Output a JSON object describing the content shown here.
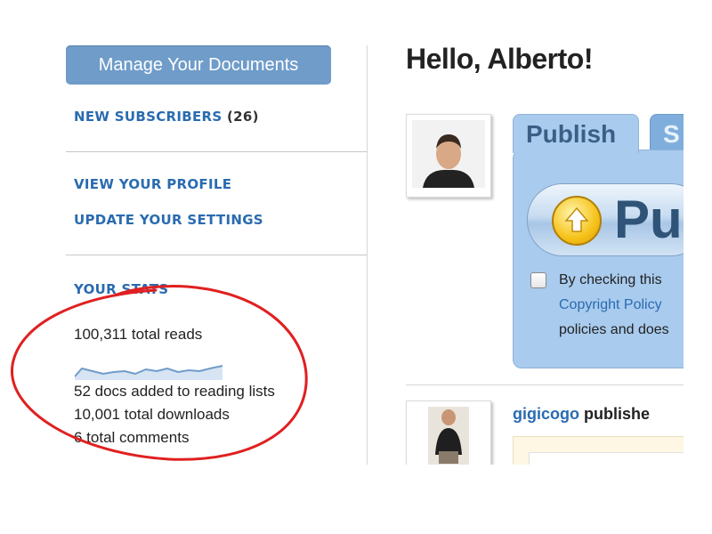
{
  "sidebar": {
    "manage_button": "Manage Your Documents",
    "new_subscribers": {
      "label": "NEW SUBSCRIBERS",
      "count": "(26)"
    },
    "view_profile": "VIEW YOUR PROFILE",
    "update_settings": "UPDATE YOUR SETTINGS",
    "stats": {
      "heading": "YOUR STATS",
      "total_reads": "100,311 total reads",
      "reading_lists": "52 docs added to reading lists",
      "total_downloads": "10,001 total downloads",
      "total_comments": "6 total comments"
    }
  },
  "main": {
    "greeting": "Hello, Alberto!",
    "tabs": {
      "publish": "Publish",
      "second": "S"
    },
    "publish_button_partial": "Pu",
    "upload_icon": "arrow-up-circle-icon",
    "panel_lines": {
      "line1": "By checking this",
      "link": "Copyright Policy",
      "line3": "policies and does"
    },
    "feed": {
      "user": "gigicogo",
      "action": "publishe"
    }
  },
  "colors": {
    "accent": "#2a6bb0",
    "button": "#6f9cc9",
    "panel": "#a9cbee",
    "annotation_circle": "#e02020"
  }
}
